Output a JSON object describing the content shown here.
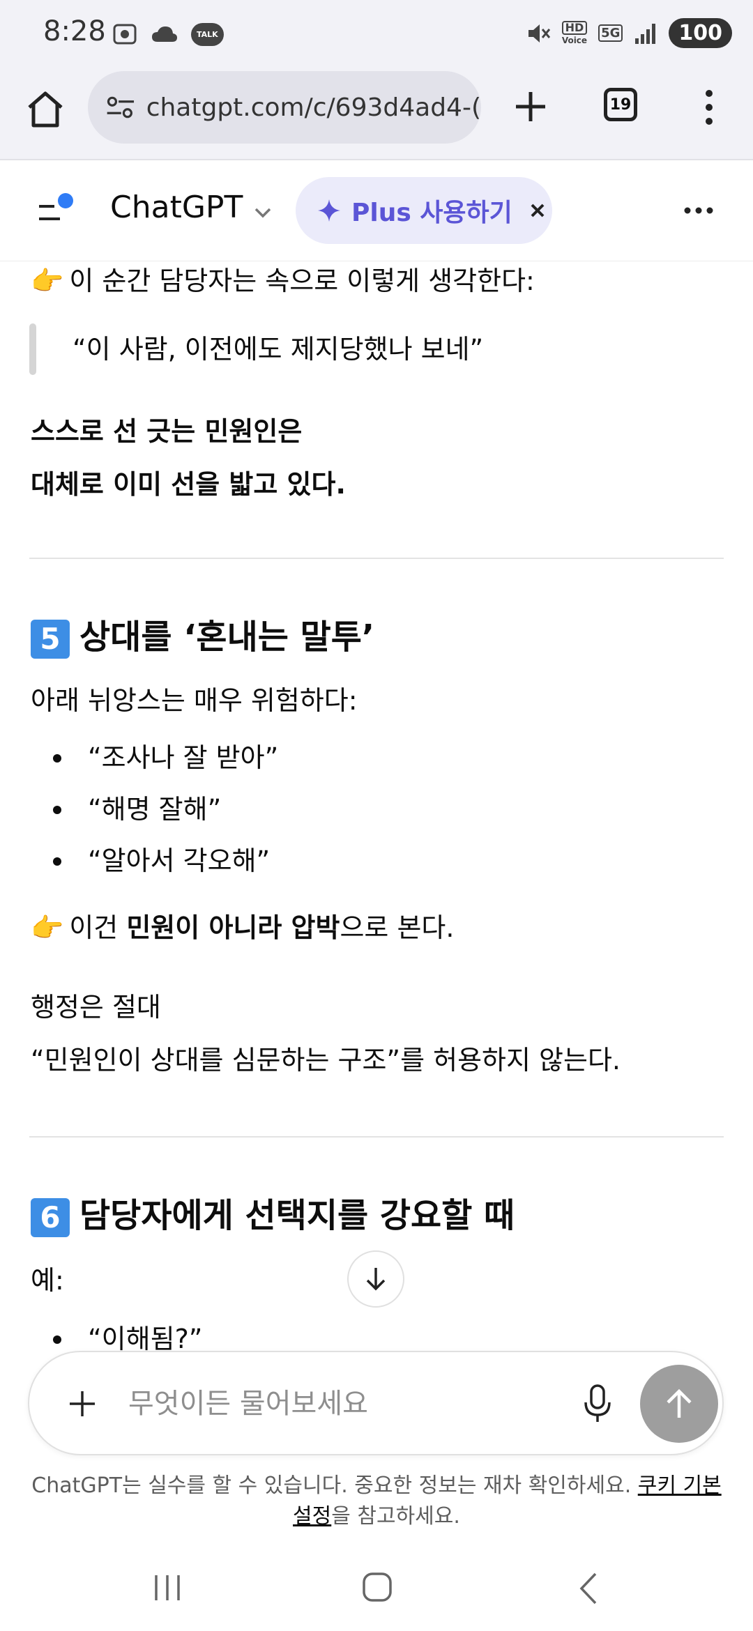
{
  "status_bar": {
    "time": "8:28",
    "talk": "TALK",
    "hd": "HD",
    "voice": "Voice",
    "net": "5G",
    "battery": "100"
  },
  "browser": {
    "url": "chatgpt.com/c/693d4ad4-(",
    "tab_count": "19"
  },
  "header": {
    "title": "ChatGPT",
    "plus_label": "Plus 사용하기"
  },
  "content": {
    "line1": "이 순간 담당자는 속으로 이렇게 생각한다:",
    "quote": "“이 사람, 이전에도 제지당했나 보네”",
    "bold1": "스스로 선 긋는 민원인은",
    "bold2": "대체로 이미 선을 밟고 있다.",
    "h5_num": "5",
    "h5_title": "상대를 ‘혼내는 말투’",
    "p5": "아래 뉘앙스는 매우 위험하다:",
    "bullets5": [
      "“조사나 잘 받아”",
      "“해명 잘해”",
      "“알아서 각오해”"
    ],
    "point_pre": "이건 ",
    "point_bold": "민원이 아니라 압박",
    "point_post": "으로 본다.",
    "admin1": "행정은 절대",
    "admin2": "“민원인이 상대를 심문하는 구조”를 허용하지 않는다.",
    "h6_num": "6",
    "h6_title": "담당자에게 선택지를 강요할 때",
    "example_label": "예:",
    "bullets6": [
      "“이해됨?”"
    ]
  },
  "composer": {
    "placeholder": "무엇이든 물어보세요"
  },
  "disclaimer": {
    "pre": "ChatGPT는 실수를 할 수 있습니다. 중요한 정보는 재차 확인하세요. ",
    "link": "쿠키 기본 설정",
    "post": "을 참고하세요."
  },
  "colors": {
    "accent": "#5b55d6",
    "badge_blue": "#3d8ee5",
    "sidebar_dot": "#2f7cf6"
  }
}
